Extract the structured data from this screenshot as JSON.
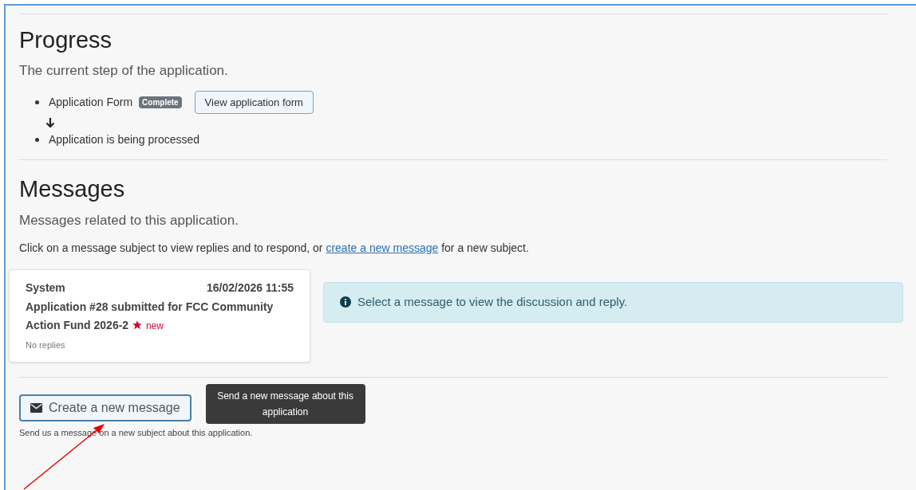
{
  "progress": {
    "title": "Progress",
    "subtitle": "The current step of the application.",
    "steps": [
      {
        "label": "Application Form",
        "badge": "Complete",
        "button": "View application form"
      },
      {
        "label": "Application is being processed"
      }
    ]
  },
  "messages": {
    "title": "Messages",
    "subtitle": "Messages related to this application.",
    "instructions": {
      "before": "Click on a message subject to view replies and to respond, or ",
      "link": "create a new message",
      "after": " for a new subject."
    },
    "items": [
      {
        "sender": "System",
        "date": "16/02/2026 11:55",
        "subject": "Application #28 submitted for FCC Community Action Fund 2026-2",
        "new": true,
        "new_label": "new",
        "replies": "No replies"
      }
    ],
    "info": "Select a message to view the discussion and reply.",
    "create_button": "Create a new message",
    "tooltip": "Send a new message about this application",
    "help": "Send us a message on a new subject about this application."
  }
}
